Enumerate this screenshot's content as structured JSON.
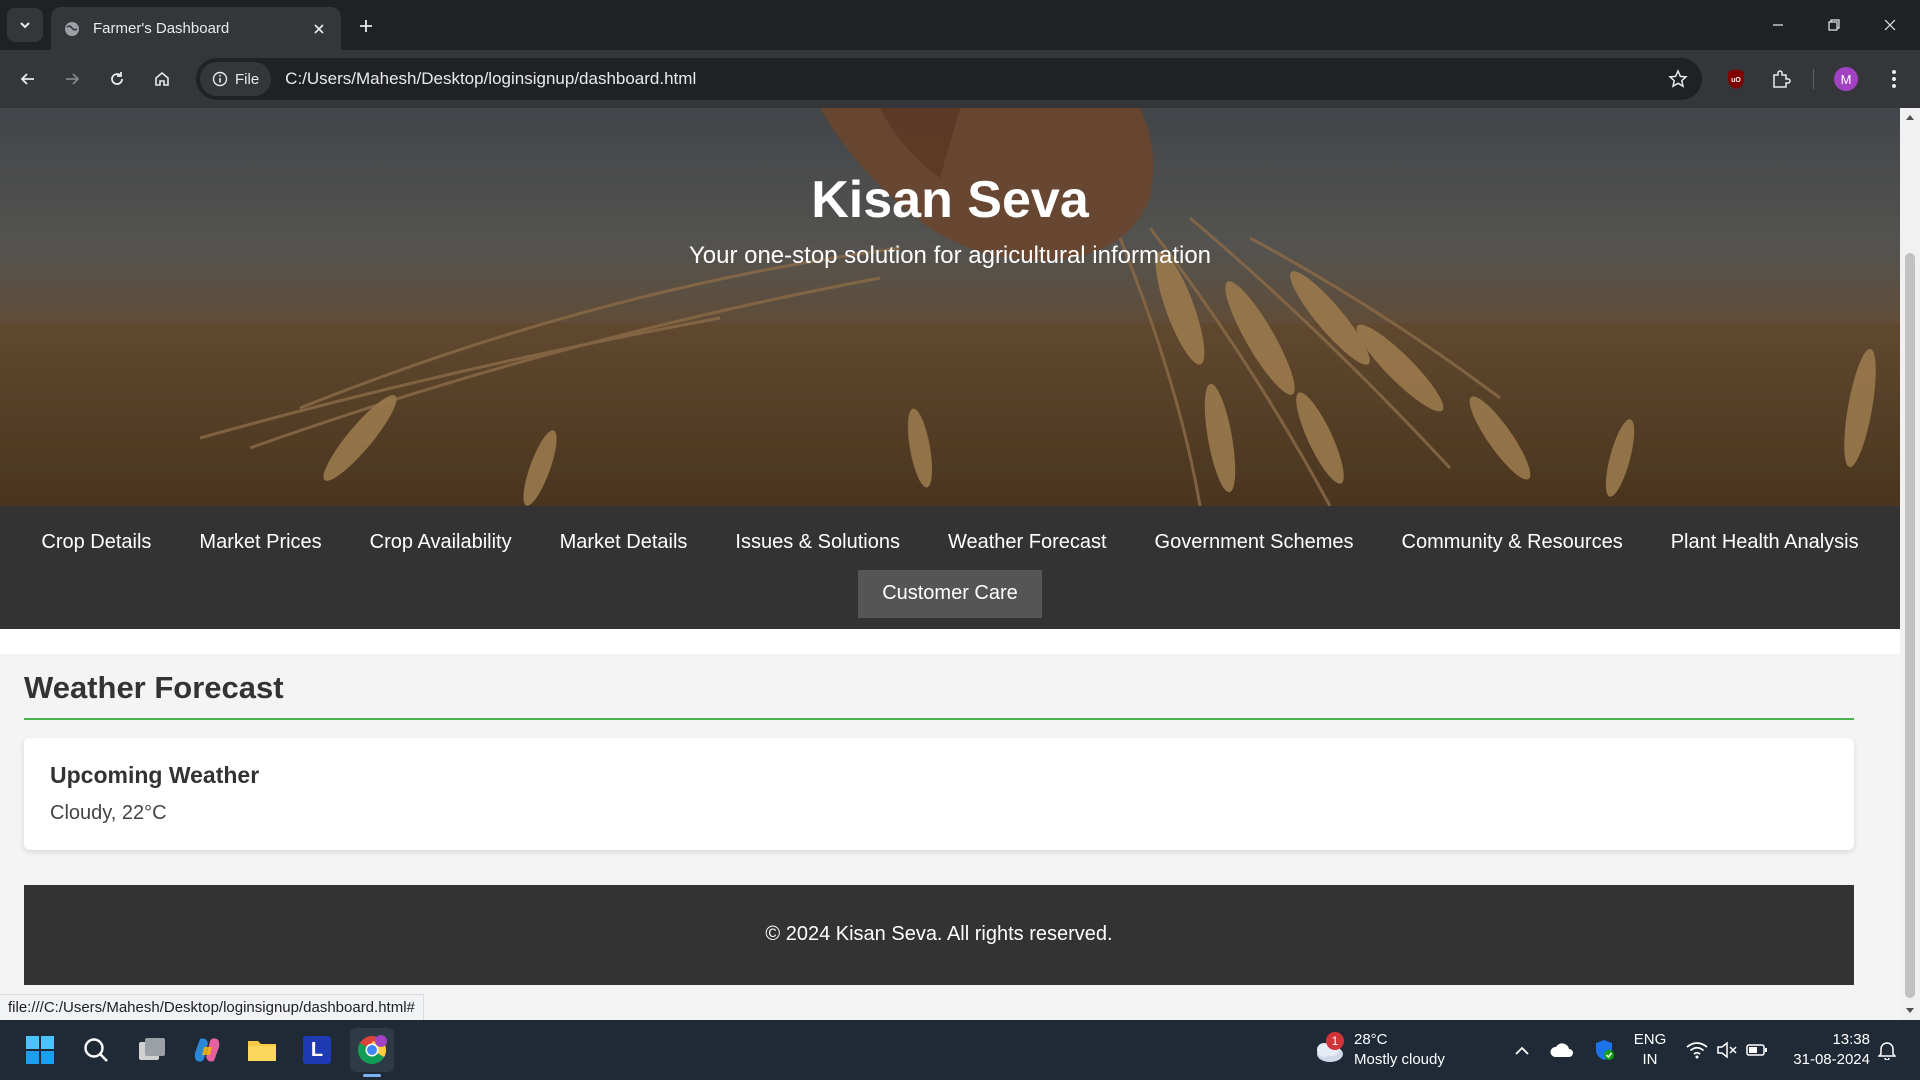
{
  "browser": {
    "tab_title": "Farmer's Dashboard",
    "file_chip": "File",
    "url": "C:/Users/Mahesh/Desktop/loginsignup/dashboard.html",
    "profile_initial": "M",
    "status_url": "file:///C:/Users/Mahesh/Desktop/loginsignup/dashboard.html#"
  },
  "hero": {
    "title": "Kisan Seva",
    "subtitle": "Your one-stop solution for agricultural information"
  },
  "nav": {
    "items": [
      {
        "label": "Crop Details"
      },
      {
        "label": "Market Prices"
      },
      {
        "label": "Crop Availability"
      },
      {
        "label": "Market Details"
      },
      {
        "label": "Issues & Solutions"
      },
      {
        "label": "Weather Forecast"
      },
      {
        "label": "Government Schemes"
      },
      {
        "label": "Community & Resources"
      },
      {
        "label": "Plant Health Analysis"
      },
      {
        "label": "Customer Care"
      }
    ]
  },
  "main": {
    "section_title": "Weather Forecast",
    "card": {
      "heading": "Upcoming Weather",
      "text": "Cloudy, 22°C"
    }
  },
  "footer": {
    "text": "© 2024 Kisan Seva. All rights reserved."
  },
  "taskbar": {
    "weather_temp": "28°C",
    "weather_desc": "Mostly cloudy",
    "weather_badge": "1",
    "lang_line1": "ENG",
    "lang_line2": "IN",
    "time": "13:38",
    "date": "31-08-2024",
    "app_letter": "L"
  },
  "colors": {
    "accent_green": "#4caf50",
    "nav_bg": "#333333",
    "nav_active_bg": "#555555",
    "chrome_bg": "#202124"
  }
}
